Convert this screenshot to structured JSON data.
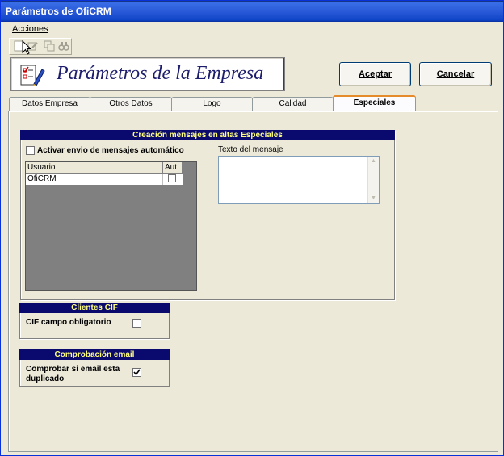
{
  "window": {
    "title": "Parámetros de OfiCRM"
  },
  "menu": {
    "acciones": "Acciones"
  },
  "toolbar": {
    "icons": [
      "new-icon",
      "edit-icon",
      "copy-icon",
      "binoculars-icon"
    ]
  },
  "header": {
    "title": "Parámetros de la Empresa"
  },
  "buttons": {
    "accept": "Aceptar",
    "cancel": "Cancelar"
  },
  "tabs": [
    {
      "label": "Datos Empresa",
      "active": false
    },
    {
      "label": "Otros Datos",
      "active": false
    },
    {
      "label": "Logo",
      "active": false
    },
    {
      "label": "Calidad",
      "active": false
    },
    {
      "label": "Especiales",
      "active": true
    }
  ],
  "mensajes": {
    "title": "Creación mensajes en altas Especiales",
    "auto_label": "Activar envio de mensajes automático",
    "auto_checked": false,
    "text_label": "Texto del mensaje",
    "text_value": "",
    "grid": {
      "columns": [
        "Usuario",
        "Aut"
      ],
      "rows": [
        {
          "usuario": "OfiCRM",
          "aut": false
        }
      ]
    }
  },
  "clientes_cif": {
    "title": "Clientes CIF",
    "label": "CIF  campo obligatorio",
    "checked": false
  },
  "comprobacion_email": {
    "title": "Comprobación email",
    "label_line1": "Comprobar si email esta",
    "label_line2": "duplicado",
    "checked": true
  },
  "colors": {
    "title_bar": "#0a246a",
    "group_title_bg": "#0a0a6e",
    "group_title_fg": "#ffff80",
    "tab_active_accent": "#e68b2c"
  }
}
